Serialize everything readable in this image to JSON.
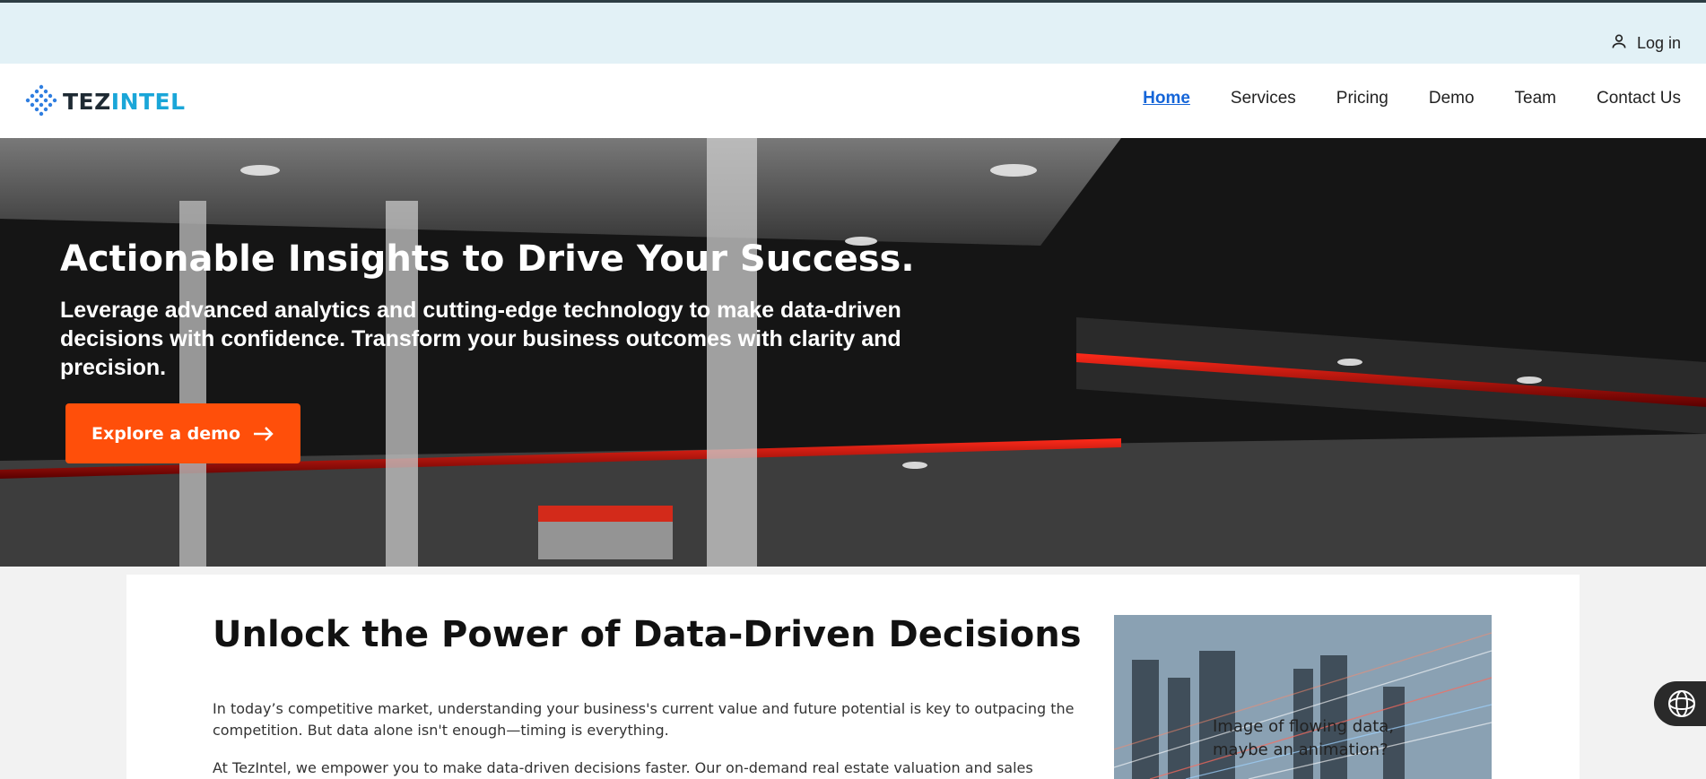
{
  "topbar": {
    "login_label": "Log in",
    "login_icon": "user-icon"
  },
  "brand": {
    "logo_part1": "TEZ",
    "logo_part2": "INTEL",
    "colors": {
      "dark": "#1e2a33",
      "accent": "#1aa6d8"
    }
  },
  "nav": {
    "items": [
      {
        "label": "Home",
        "active": true
      },
      {
        "label": "Services"
      },
      {
        "label": "Pricing"
      },
      {
        "label": "Demo"
      },
      {
        "label": "Team"
      },
      {
        "label": "Contact Us"
      }
    ]
  },
  "hero": {
    "title": "Actionable Insights to Drive Your Success.",
    "subtitle": "Leverage advanced analytics and cutting-edge technology to make data-driven decisions with confidence. Transform your business outcomes with clarity and precision.",
    "cta_label": "Explore a demo",
    "cta_color": "#ff4f0a"
  },
  "content": {
    "title": "Unlock the Power of Data-Driven Decisions",
    "paragraph1": "In today’s competitive market, understanding your business's current value and future potential is key to outpacing the competition. But data alone isn't enough—timing is everything.",
    "paragraph2": "At TezIntel, we empower you to make data-driven decisions faster. Our on-demand real estate valuation and sales forecasting tool cuts",
    "image_caption_line1": "Image of flowing data,",
    "image_caption_line2": "maybe an animation?"
  },
  "chat_widget": {
    "icon": "chat-assistant-icon"
  }
}
